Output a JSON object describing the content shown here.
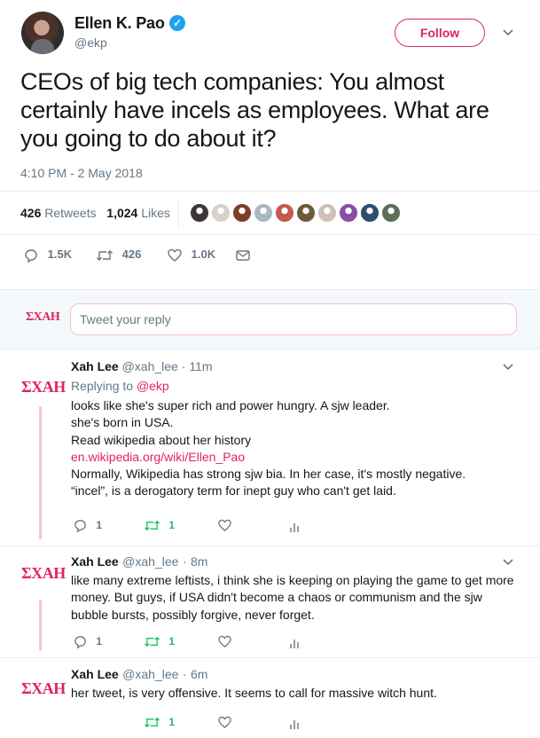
{
  "author": {
    "name": "Ellen K. Pao",
    "handle": "@ekp",
    "follow_label": "Follow"
  },
  "tweet": {
    "text": "CEOs of big tech companies: You almost certainly have incels as employees. What are you going to do about it?",
    "timestamp": "4:10 PM - 2 May 2018",
    "retweets_count": "426",
    "retweets_label": "Retweets",
    "likes_count": "1,024",
    "likes_label": "Likes",
    "actions": {
      "replies": "1.5K",
      "retweets": "426",
      "likes": "1.0K"
    }
  },
  "likers": {
    "colors": [
      "#3d3536",
      "#d8d0cc",
      "#7b3f2a",
      "#aab8c2",
      "#c25b4b",
      "#6e5a3b",
      "#cfc1b8",
      "#8a4ea3",
      "#2c4e70",
      "#5c6e58"
    ]
  },
  "reply_box": {
    "logo": "ΣXAH",
    "placeholder": "Tweet your reply"
  },
  "replies": [
    {
      "name": "Xah Lee",
      "handle": "@xah_lee",
      "time": "11m",
      "replying_label": "Replying to",
      "replying_to": "@ekp",
      "line1": "looks like she's super rich and power hungry. A sjw leader.",
      "line2": "she's born in USA.",
      "line3": "Read wikipedia about her history",
      "link": "en.wikipedia.org/wiki/Ellen_Pao",
      "line4": "Normally, Wikipedia has strong sjw bia. In her case, it's mostly negative.",
      "line5": "“incel”, is a derogatory term for inept guy who can't get laid.",
      "reply_count": "1",
      "retweet_count": "1"
    },
    {
      "name": "Xah Lee",
      "handle": "@xah_lee",
      "time": "8m",
      "text": "like many extreme leftists, i think she is keeping on playing the game to get more money. But guys, if USA didn't become a chaos or communism and the sjw bubble bursts, possibly forgive, never forget.",
      "reply_count": "1",
      "retweet_count": "1"
    },
    {
      "name": "Xah Lee",
      "handle": "@xah_lee",
      "time": "6m",
      "text": "her tweet, is very offensive. It seems to call for massive witch hunt.",
      "retweet_count": "1"
    }
  ],
  "logo_text": "ΣXAH",
  "colors": {
    "accent": "#e0245e",
    "verified": "#1da1f2",
    "muted": "#657786",
    "retweet_green": "#17bf63"
  }
}
